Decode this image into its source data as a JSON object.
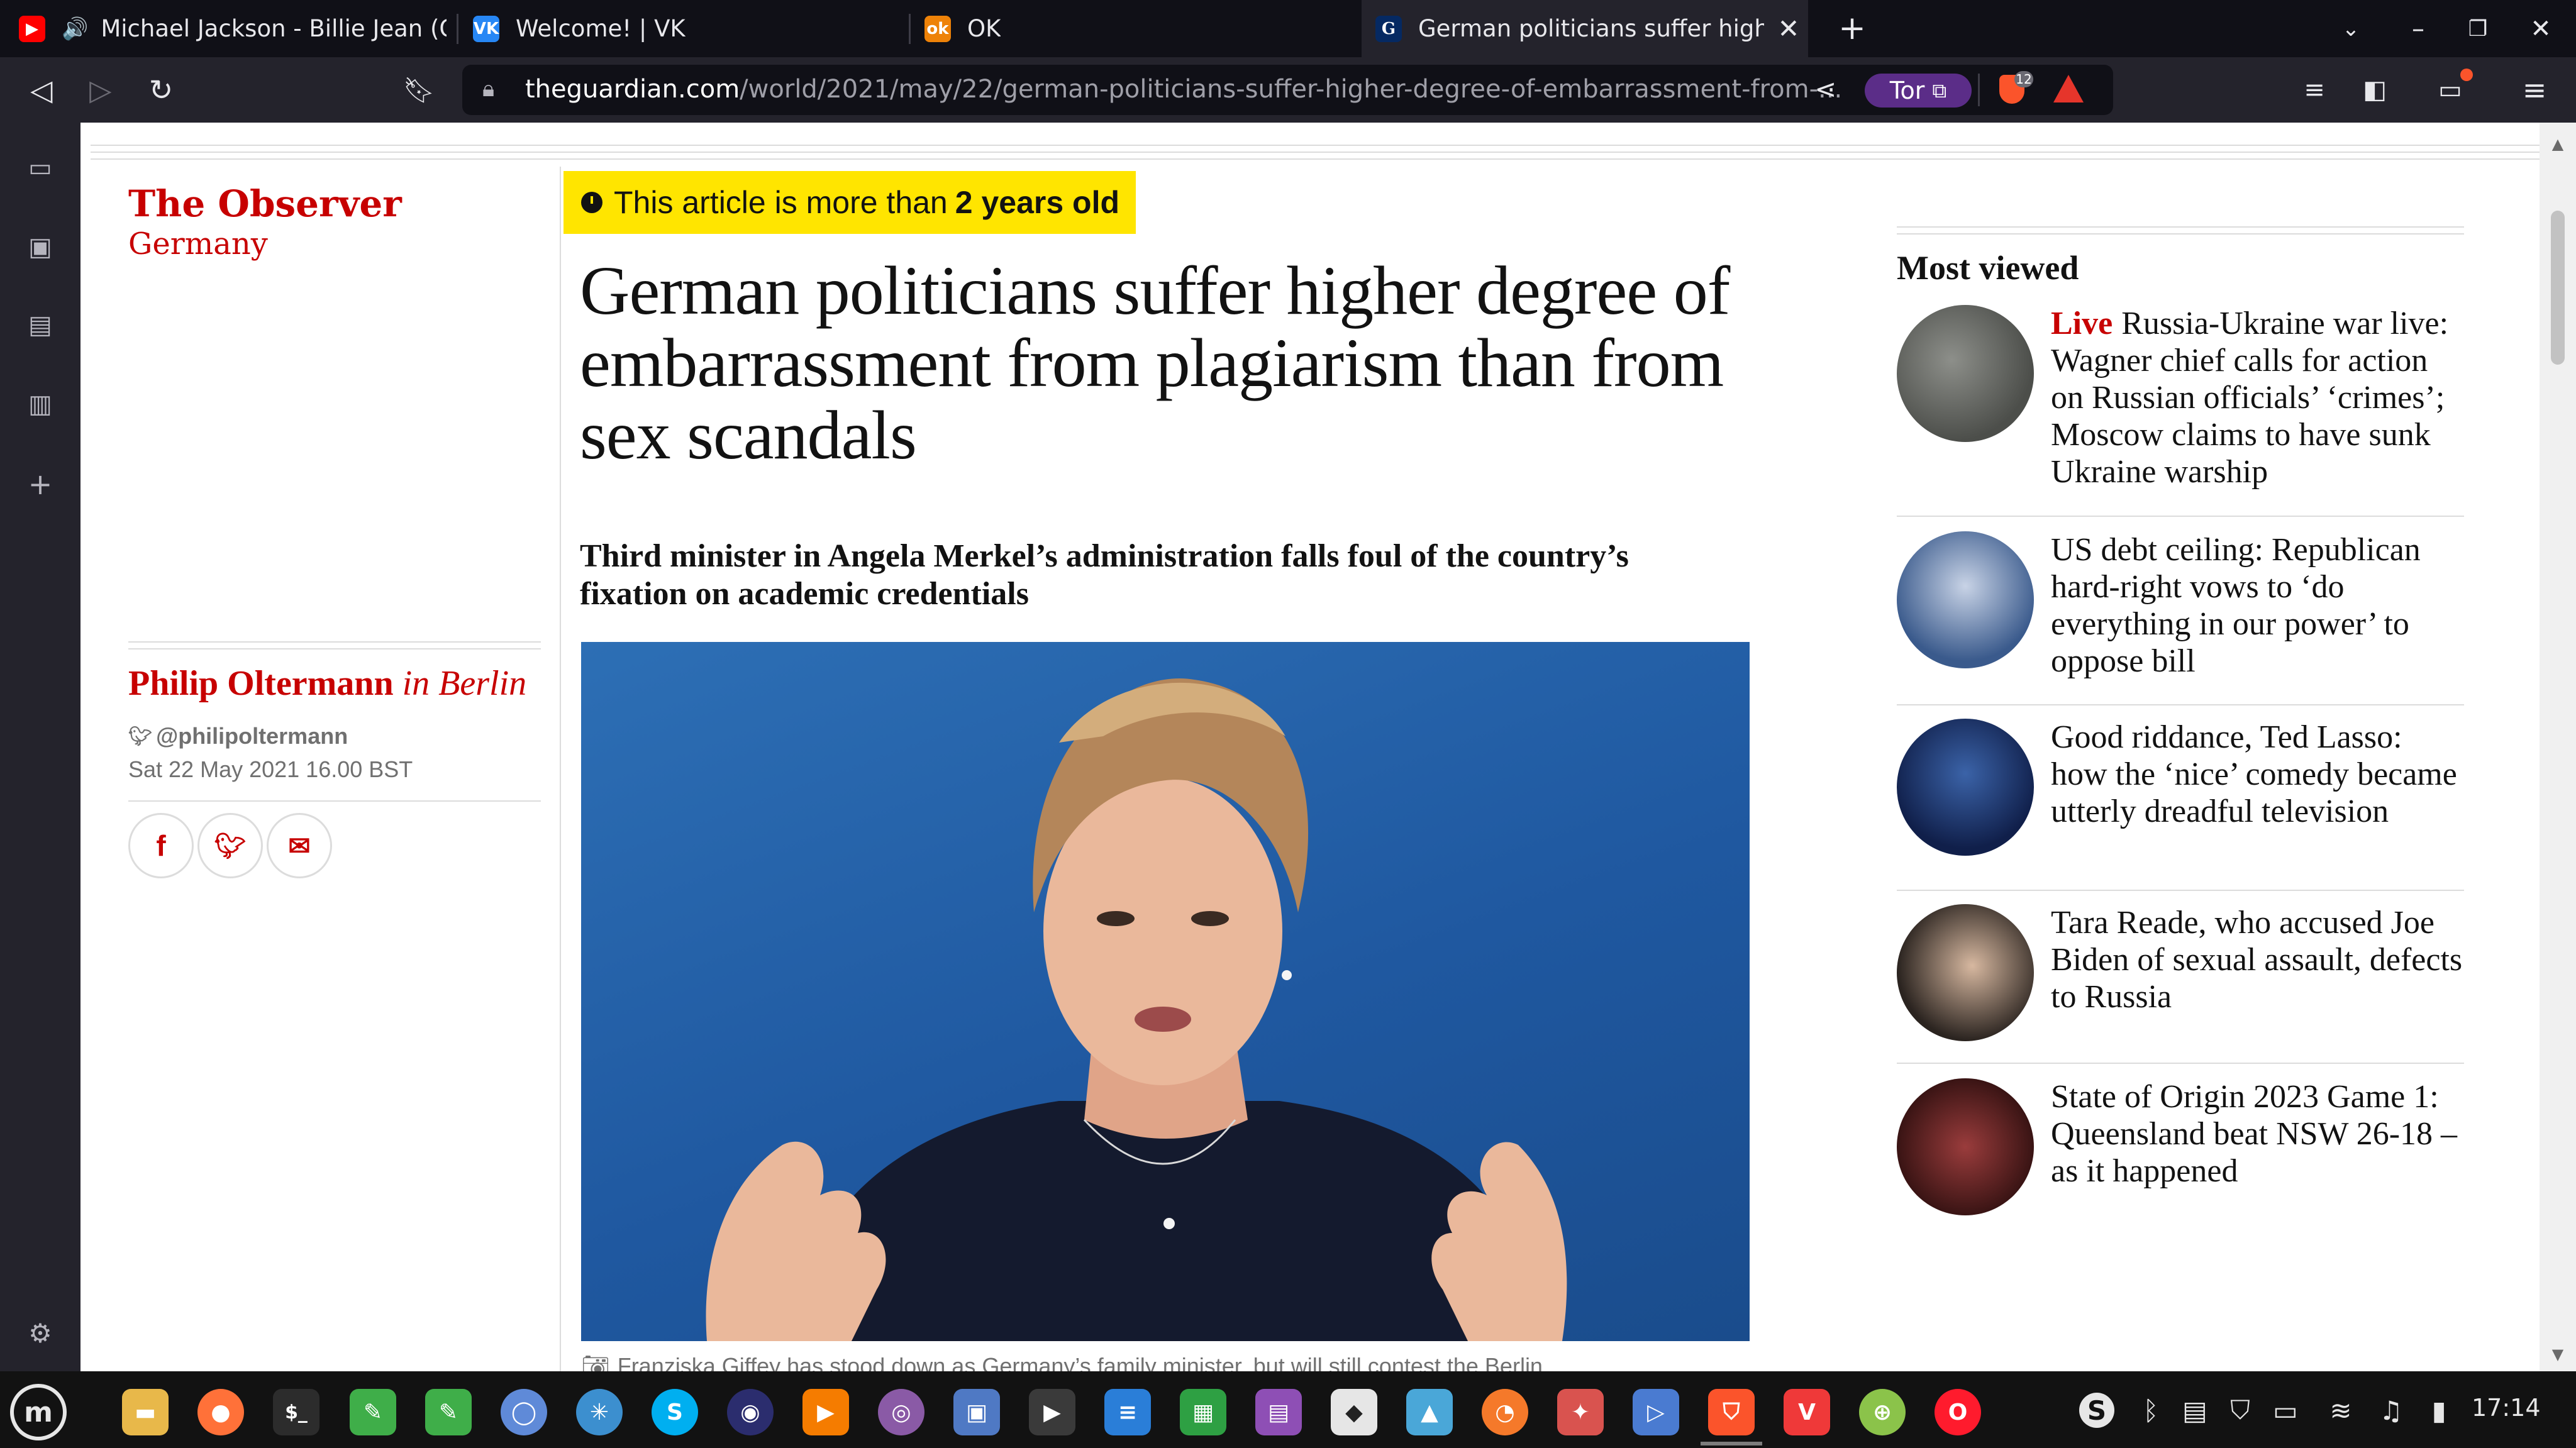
{
  "tabs": [
    {
      "label": "Michael Jackson - Billie Jean (O",
      "favicon": "youtube-icon",
      "audio": "speaker-icon",
      "color": "#ff0000"
    },
    {
      "label": "Welcome! | VK",
      "favicon": "vk-icon",
      "color": "#2787f5"
    },
    {
      "label": "OK",
      "favicon": "ok-icon",
      "color": "#ee8208"
    },
    {
      "label": "German politicians suffer high",
      "favicon": "guardian-icon",
      "color": "#052962"
    }
  ],
  "toolbar": {
    "url_host": "theguardian.com",
    "url_path": "/world/2021/may/22/german-politicians-suffer-higher-degree-of-embarrassment-from-...",
    "tor_label": "Tor",
    "shield_count": "12"
  },
  "article": {
    "section": "The Observer",
    "subsection": "Germany",
    "age_banner_prefix": "This article is more than",
    "age_banner_bold": "2 years old",
    "headline": "German politicians suffer higher degree of embarrassment from plagiarism than from sex scandals",
    "standfirst": "Third minister in Angela Merkel’s administration falls foul of the country’s fixation on academic credentials",
    "author": "Philip Oltermann",
    "author_location": "in Berlin",
    "twitter": "@philipoltermann",
    "date": "Sat 22 May 2021 16.00 BST",
    "caption": "Franziska Giffey has stood down as Germany’s family minister, but will still contest the Berlin"
  },
  "most_viewed": {
    "title": "Most viewed",
    "items": [
      {
        "live": "Live",
        "text": "Russia-Ukraine war live: Wagner chief calls for action on Russian officials’ ‘crimes’; Moscow claims to have sunk Ukraine warship"
      },
      {
        "live": "",
        "text": "US debt ceiling: Republican hard-right vows to ‘do everything in our power’ to oppose bill"
      },
      {
        "live": "",
        "text": "Good riddance, Ted Lasso: how the ‘nice’ comedy became utterly dreadful television"
      },
      {
        "live": "",
        "text": "Tara Reade, who accused Joe Biden of sexual assault, defects to Russia"
      },
      {
        "live": "",
        "text": "State of Origin 2023 Game 1: Queensland beat NSW 26-18 – as it happened"
      }
    ]
  },
  "taskbar": {
    "clock": "17:14"
  },
  "colors": {
    "guardian_red": "#c70000",
    "banner_yellow": "#ffe500",
    "tor_purple": "#5b2d88"
  }
}
